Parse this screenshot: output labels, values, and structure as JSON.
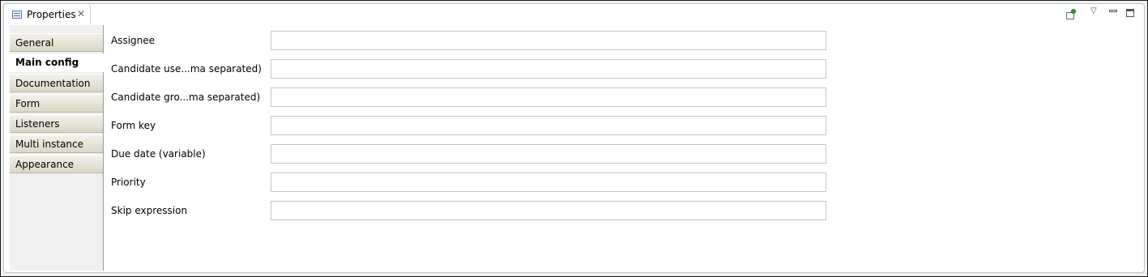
{
  "view": {
    "tab_title": "Properties",
    "tab_icon": "properties-table-icon",
    "toolbar_icons": [
      "pin-icon",
      "view-menu-icon",
      "minimize-icon",
      "maximize-icon"
    ]
  },
  "sidebar": {
    "items": [
      {
        "label": "General",
        "selected": false
      },
      {
        "label": "Main config",
        "selected": true
      },
      {
        "label": "Documentation",
        "selected": false
      },
      {
        "label": "Form",
        "selected": false
      },
      {
        "label": "Listeners",
        "selected": false
      },
      {
        "label": "Multi instance",
        "selected": false
      },
      {
        "label": "Appearance",
        "selected": false
      }
    ]
  },
  "form": {
    "fields": [
      {
        "label": "Assignee",
        "value": ""
      },
      {
        "label": "Candidate use...ma separated)",
        "value": ""
      },
      {
        "label": "Candidate gro...ma separated)",
        "value": ""
      },
      {
        "label": "Form key",
        "value": ""
      },
      {
        "label": "Due date (variable)",
        "value": ""
      },
      {
        "label": "Priority",
        "value": ""
      },
      {
        "label": "Skip expression",
        "value": ""
      }
    ]
  }
}
